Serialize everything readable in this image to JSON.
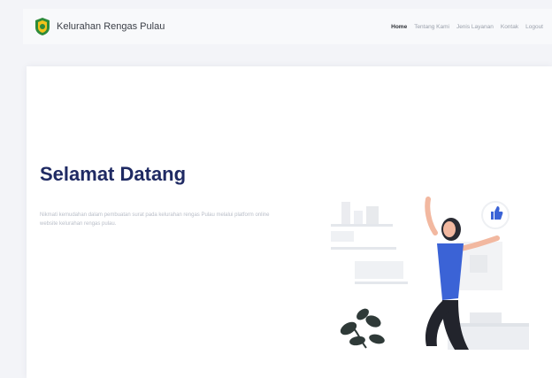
{
  "brand": {
    "name": "Kelurahan Rengas Pulau",
    "logo_icon": "shield-emblem-icon",
    "logo_color": "#2e8b3a"
  },
  "nav": {
    "links": [
      {
        "label": "Home",
        "active": true
      },
      {
        "label": "Tentang Kami",
        "active": false
      },
      {
        "label": "Jenis Layanan",
        "active": false
      },
      {
        "label": "Kontak",
        "active": false
      },
      {
        "label": "Logout",
        "active": false
      }
    ]
  },
  "hero": {
    "title": "Selamat Datang",
    "text": "Nikmati kemudahan dalam pembuatan surat pada kelurahan rengas Pulau melalui platform online website kelurahan rengas pulau."
  },
  "colors": {
    "title": "#1f2a63",
    "accent_blue": "#3b63d6",
    "background": "#f3f4f8"
  }
}
